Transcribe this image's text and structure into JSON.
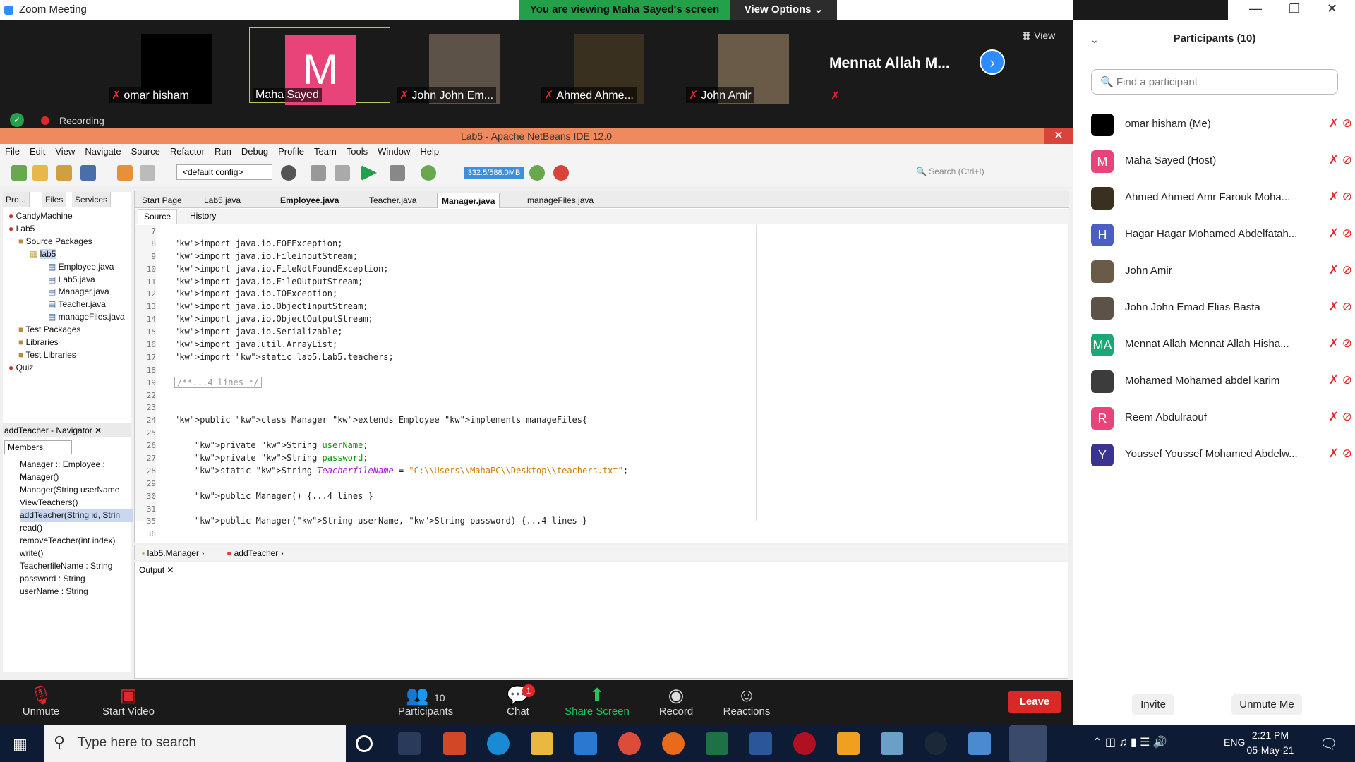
{
  "app_title": "Zoom Meeting",
  "banner": {
    "viewing": "You are viewing Maha Sayed's screen",
    "view_options": "View Options ⌄"
  },
  "video_tiles": [
    {
      "name": "omar hisham",
      "color": "#000000"
    },
    {
      "name": "Maha Sayed",
      "color": "#e8447a",
      "initial": "M"
    },
    {
      "name": "John John Em...",
      "color": "#5c5248"
    },
    {
      "name": "Ahmed Ahme...",
      "color": "#3a3020"
    },
    {
      "name": "John Amir",
      "color": "#6a5a48"
    }
  ],
  "big_name": "Mennat Allah M...",
  "view_label": "View",
  "recording_label": "Recording",
  "netbeans": {
    "title": "Lab5 - Apache NetBeans IDE 12.0",
    "menu": [
      "File",
      "Edit",
      "View",
      "Navigate",
      "Source",
      "Refactor",
      "Run",
      "Debug",
      "Profile",
      "Team",
      "Tools",
      "Window",
      "Help"
    ],
    "config": "<default config>",
    "memory": "332.5/588.0MB",
    "search_placeholder": "Search (Ctrl+I)",
    "panel_tabs": [
      "Pro...",
      "Files",
      "Services"
    ],
    "tree": [
      "CandyMachine",
      "Lab5",
      "Source Packages",
      "lab5",
      "Employee.java",
      "Lab5.java",
      "Manager.java",
      "Teacher.java",
      "manageFiles.java",
      "Test Packages",
      "Libraries",
      "Test Libraries",
      "Quiz"
    ],
    "navigator_title": "addTeacher - Navigator",
    "navigator_filter": "Members",
    "navigator_items": [
      "Manager :: Employee : manag",
      "Manager()",
      "Manager(String userName",
      "ViewTeachers()",
      "addTeacher(String id, Strin",
      "read()",
      "removeTeacher(int index)",
      "write()",
      "TeacherfileName : String",
      "password : String",
      "userName : String"
    ],
    "editor_tabs": [
      "Start Page",
      "Lab5.java",
      "Employee.java",
      "Teacher.java",
      "Manager.java",
      "manageFiles.java"
    ],
    "source_label": "Source",
    "history_label": "History",
    "line_numbers": [
      "7",
      "8",
      "9",
      "10",
      "11",
      "12",
      "13",
      "14",
      "15",
      "16",
      "17",
      "18",
      "19",
      "22",
      "23",
      "24",
      "25",
      "26",
      "27",
      "28",
      "29",
      "30",
      "31",
      "35",
      "36"
    ],
    "code_lines": [
      "",
      "import java.io.EOFException;",
      "import java.io.FileInputStream;",
      "import java.io.FileNotFoundException;",
      "import java.io.FileOutputStream;",
      "import java.io.IOException;",
      "import java.io.ObjectInputStream;",
      "import java.io.ObjectOutputStream;",
      "import java.io.Serializable;",
      "import java.util.ArrayList;",
      "import static lab5.Lab5.teachers;",
      "",
      "/**...4 lines */",
      "",
      "",
      "public class Manager extends Employee implements manageFiles{",
      "",
      "    private String userName;",
      "    private String password;",
      "    static String TeacherfileName = \"C:\\\\Users\\\\MahaPC\\\\Desktop\\\\teachers.txt\";",
      "",
      "    public Manager() {...4 lines }",
      "",
      "    public Manager(String userName, String password) {...4 lines }",
      ""
    ],
    "breadcrumb": [
      "lab5.Manager",
      "addTeacher"
    ],
    "output_tab": "Output"
  },
  "zoom_toolbar": {
    "unmute": "Unmute",
    "start_video": "Start Video",
    "participants": "Participants",
    "participants_count": "10",
    "chat": "Chat",
    "chat_badge": "1",
    "share_screen": "Share Screen",
    "record": "Record",
    "reactions": "Reactions",
    "leave": "Leave"
  },
  "sidebar": {
    "title": "Participants (10)",
    "find_placeholder": "Find a participant",
    "participants": [
      {
        "name": "omar hisham (Me)",
        "color": "#000000",
        "initial": ""
      },
      {
        "name": "Maha Sayed (Host)",
        "color": "#e8447a",
        "initial": "M"
      },
      {
        "name": "Ahmed Ahmed Amr Farouk Moha...",
        "color": "#3a3020",
        "initial": ""
      },
      {
        "name": "Hagar Hagar Mohamed Abdelfatah...",
        "color": "#4a5fc1",
        "initial": "H"
      },
      {
        "name": "John Amir",
        "color": "#6a5a48",
        "initial": ""
      },
      {
        "name": "John John Emad Elias Basta",
        "color": "#5c5248",
        "initial": ""
      },
      {
        "name": "Mennat Allah Mennat Allah Hisha...",
        "color": "#1aa876",
        "initial": "MA"
      },
      {
        "name": "Mohamed Mohamed abdel karim",
        "color": "#3c3c3c",
        "initial": ""
      },
      {
        "name": "Reem Abdulraouf",
        "color": "#e8447a",
        "initial": "R"
      },
      {
        "name": "Youssef Youssef Mohamed Abdelw...",
        "color": "#3b3390",
        "initial": "Y"
      }
    ],
    "invite": "Invite",
    "unmute_me": "Unmute Me"
  },
  "taskbar": {
    "search_placeholder": "Type here to search",
    "lang": "ENG",
    "time": "2:21 PM",
    "date": "05-May-21"
  }
}
